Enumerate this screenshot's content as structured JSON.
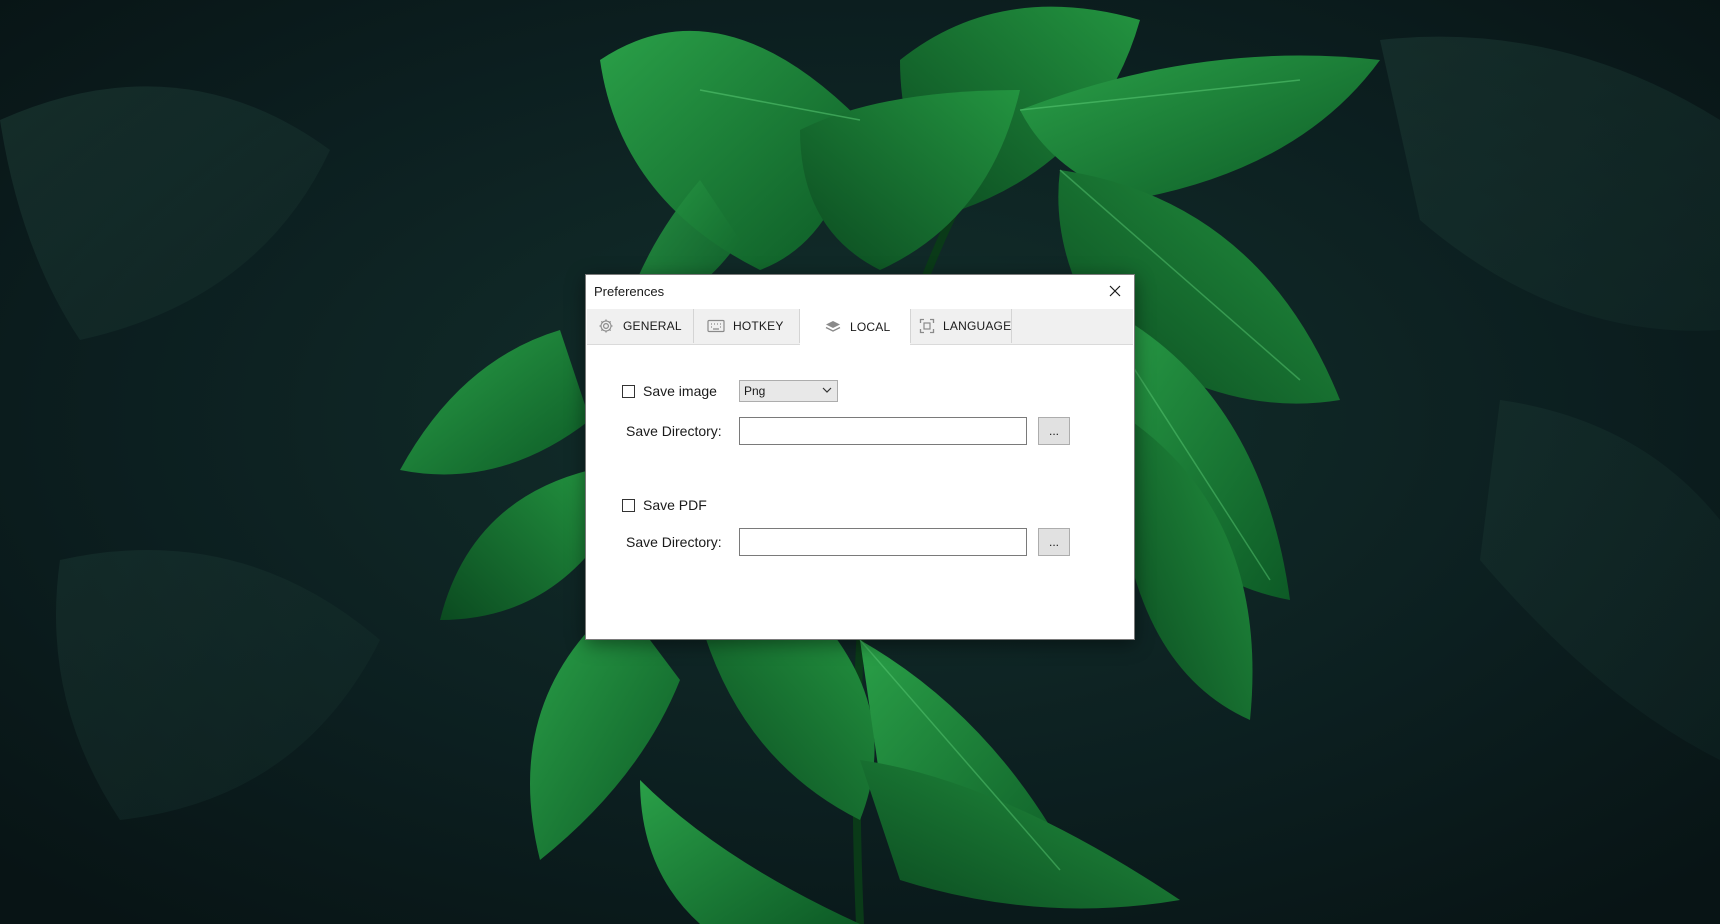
{
  "window": {
    "title": "Preferences"
  },
  "tabs": [
    {
      "label": "GENERAL",
      "icon": "gear-icon",
      "active": false
    },
    {
      "label": "HOTKEY",
      "icon": "keyboard-icon",
      "active": false
    },
    {
      "label": "LOCAL",
      "icon": "layers-icon",
      "active": true
    },
    {
      "label": "LANGUAGE",
      "icon": "scan-icon",
      "active": false
    }
  ],
  "local": {
    "save_image": {
      "label": "Save image",
      "checked": false,
      "format_selected": "Png"
    },
    "image_directory": {
      "label": "Save Directory:",
      "value": "",
      "browse_label": "..."
    },
    "save_pdf": {
      "label": "Save PDF",
      "checked": false
    },
    "pdf_directory": {
      "label": "Save Directory:",
      "value": "",
      "browse_label": "..."
    }
  },
  "colors": {
    "leaf_dark": "#0f5a2a",
    "leaf_bright": "#1f8a3a",
    "background_dark": "#0b1a1c",
    "tab_strip": "#f0f0f0"
  }
}
